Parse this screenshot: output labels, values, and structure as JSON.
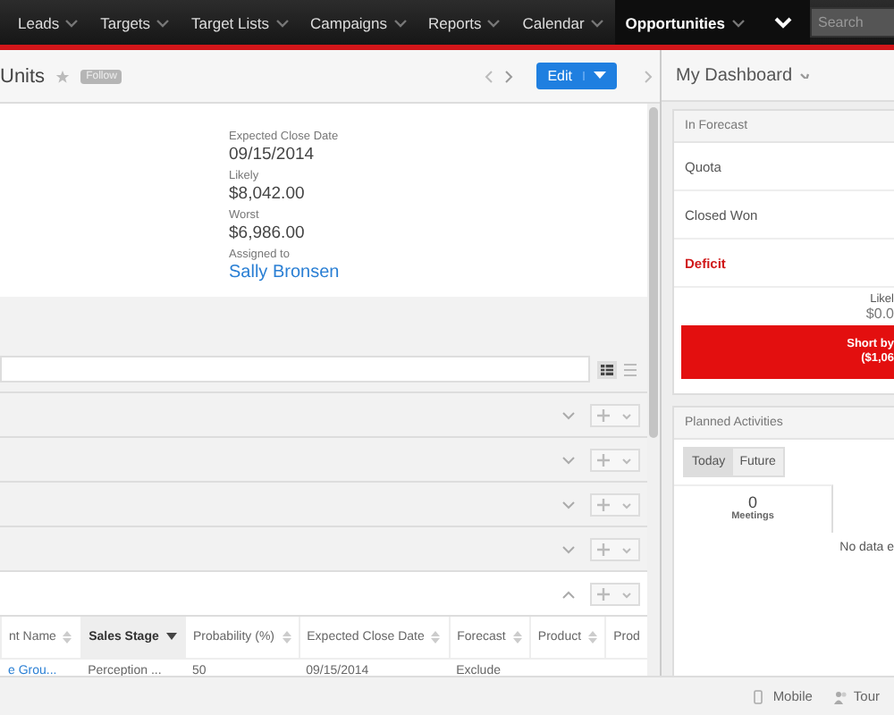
{
  "nav": {
    "items": [
      {
        "label": "Leads",
        "selected": false
      },
      {
        "label": "Targets",
        "selected": false
      },
      {
        "label": "Target Lists",
        "selected": false
      },
      {
        "label": "Campaigns",
        "selected": false
      },
      {
        "label": "Reports",
        "selected": false
      },
      {
        "label": "Calendar",
        "selected": false
      },
      {
        "label": "Opportunities",
        "selected": true
      }
    ],
    "search": {
      "placeholder": "Search"
    }
  },
  "record": {
    "title": "Units",
    "badge": "Follow",
    "edit_button": "Edit",
    "fields": [
      {
        "label": "Expected Close Date",
        "value": "09/15/2014",
        "kind": "text"
      },
      {
        "label": "Likely",
        "value": "$8,042.00",
        "kind": "text"
      },
      {
        "label": "Worst",
        "value": "$6,986.00",
        "kind": "text"
      },
      {
        "label": "Assigned to",
        "value": "Sally Bronsen",
        "kind": "link"
      }
    ],
    "subpanels": [
      {
        "expanded": false
      },
      {
        "expanded": false
      },
      {
        "expanded": false
      },
      {
        "expanded": false
      },
      {
        "expanded": true
      }
    ],
    "table": {
      "columns": [
        {
          "label": "nt Name",
          "sorted": false
        },
        {
          "label": "Sales Stage",
          "sorted": true
        },
        {
          "label": "Probability (%)",
          "sorted": false
        },
        {
          "label": "Expected Close Date",
          "sorted": false
        },
        {
          "label": "Forecast",
          "sorted": false
        },
        {
          "label": "Product",
          "sorted": false
        },
        {
          "label": "Prod",
          "sorted": false
        }
      ],
      "rows": [
        [
          "e Grou...",
          "Perception ...",
          "50",
          "09/15/2014",
          "Exclude"
        ]
      ]
    }
  },
  "dashboard": {
    "title": "My Dashboard",
    "forecast": {
      "title": "In Forecast",
      "rows": [
        {
          "label": "Quota",
          "kind": "normal"
        },
        {
          "label": "Closed Won",
          "kind": "normal"
        },
        {
          "label": "Deficit",
          "kind": "alert"
        }
      ],
      "likely_label": "Likel",
      "likely_value": "$0.0",
      "alert_lines": [
        "Short by",
        "($1,06"
      ]
    },
    "activities": {
      "title": "Planned Activities",
      "tabs": [
        {
          "label": "Today",
          "selected": true
        },
        {
          "label": "Future",
          "selected": false
        }
      ],
      "count": "0",
      "count_label": "Meetings",
      "empty": "No data e"
    }
  },
  "footer": {
    "links": [
      "Mobile",
      "Tour"
    ]
  }
}
